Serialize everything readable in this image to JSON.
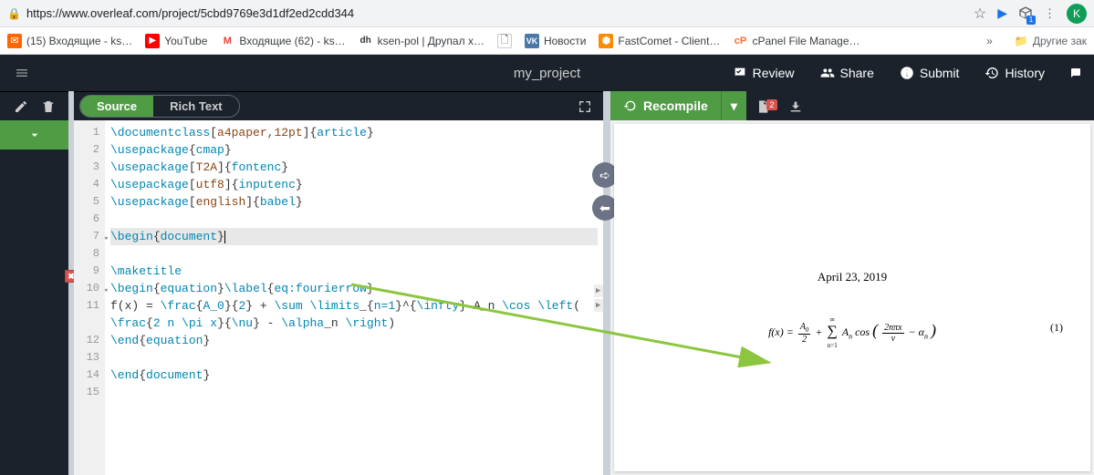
{
  "browser": {
    "url": "https://www.overleaf.com/project/5cbd9769e3d1df2ed2cdd344",
    "cube_badge": "1",
    "avatar_letter": "K"
  },
  "bookmarks": {
    "items": [
      {
        "label": "(15) Входящие - ks…"
      },
      {
        "label": "YouTube"
      },
      {
        "label": "Входящие (62) - ks…"
      },
      {
        "label": "ksen-pol | Друпал х…"
      },
      {
        "label": ""
      },
      {
        "label": "Новости"
      },
      {
        "label": "FastComet - Client…"
      },
      {
        "label": "cPanel File Manage…"
      }
    ],
    "other": "Другие зак"
  },
  "header": {
    "title": "my_project",
    "review": "Review",
    "share": "Share",
    "submit": "Submit",
    "history": "History"
  },
  "toolbar": {
    "source": "Source",
    "richtext": "Rich Text",
    "recompile": "Recompile",
    "log_badge": "2"
  },
  "code": {
    "lines": [
      {
        "n": "1",
        "raw": "\\documentclass[a4paper,12pt]{article}"
      },
      {
        "n": "2",
        "raw": "\\usepackage{cmap}"
      },
      {
        "n": "3",
        "raw": "\\usepackage[T2A]{fontenc}"
      },
      {
        "n": "4",
        "raw": "\\usepackage[utf8]{inputenc}"
      },
      {
        "n": "5",
        "raw": "\\usepackage[english]{babel}"
      },
      {
        "n": "6",
        "raw": ""
      },
      {
        "n": "7",
        "raw": "\\begin{document}",
        "fold": true,
        "hl": true,
        "cursor": true
      },
      {
        "n": "8",
        "raw": ""
      },
      {
        "n": "9",
        "raw": "\\maketitle",
        "error": true
      },
      {
        "n": "10",
        "raw": "\\begin{equation}\\label{eq:fourierrow}",
        "fold": true
      },
      {
        "n": "11",
        "raw": "f(x) = \\frac{A_0}{2} + \\sum \\limits_{n=1}^{\\infty} A_n \\cos \\left("
      },
      {
        "n": "",
        "raw": "\\frac{2 n \\pi x}{\\nu} - \\alpha_n \\right)"
      },
      {
        "n": "12",
        "raw": "\\end{equation}"
      },
      {
        "n": "13",
        "raw": ""
      },
      {
        "n": "14",
        "raw": "\\end{document}"
      },
      {
        "n": "15",
        "raw": ""
      }
    ]
  },
  "pdf": {
    "date": "April 23, 2019",
    "eq_num": "(1)"
  }
}
